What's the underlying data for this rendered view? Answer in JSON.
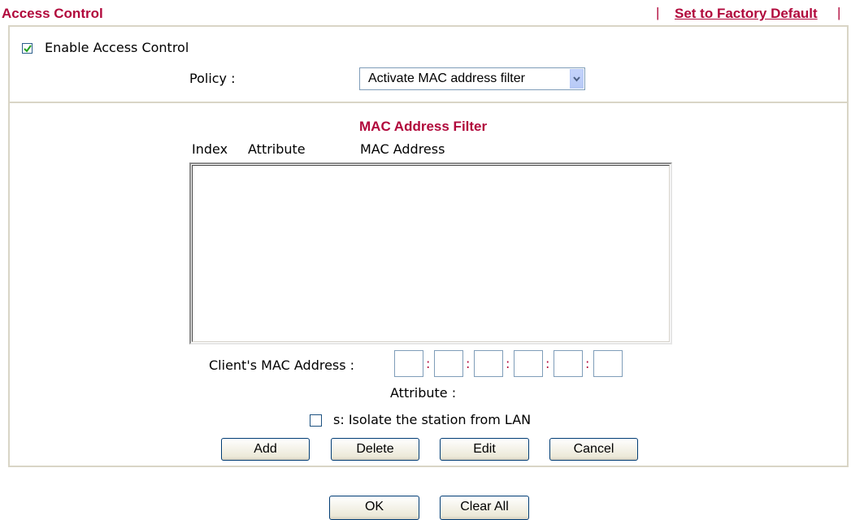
{
  "header": {
    "title": "Access Control",
    "separator": "|",
    "factory_default_link": "Set to Factory Default"
  },
  "access": {
    "enable_label": "Enable Access Control",
    "enable_checked": true,
    "policy_label": "Policy :",
    "policy_value": "Activate MAC address filter"
  },
  "filter": {
    "title": "MAC Address Filter",
    "columns": [
      "Index",
      "Attribute",
      "MAC Address"
    ],
    "entries": [],
    "client_mac_label": "Client's MAC Address :",
    "mac_separator": ":",
    "mac_octets": [
      "",
      "",
      "",
      "",
      "",
      ""
    ],
    "attribute_label": "Attribute :",
    "isolate_label": "s: Isolate the station from LAN",
    "isolate_checked": false
  },
  "buttons": {
    "add": "Add",
    "delete": "Delete",
    "edit": "Edit",
    "cancel": "Cancel",
    "ok": "OK",
    "clear_all": "Clear All"
  },
  "colors": {
    "accent": "#b1093c",
    "panel_border": "#d9d5c6",
    "input_border": "#7f9db9"
  }
}
